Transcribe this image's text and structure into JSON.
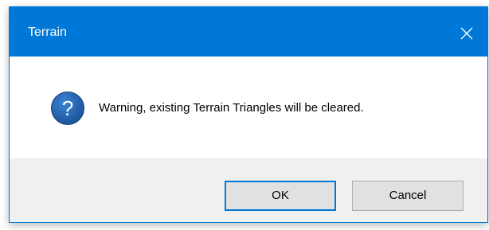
{
  "dialog": {
    "title": "Terrain",
    "close_icon": "close-icon",
    "message_icon": "question-icon",
    "message": "Warning, existing Terrain Triangles will be cleared.",
    "buttons": {
      "ok_label": "OK",
      "cancel_label": "Cancel"
    }
  },
  "colors": {
    "titlebar": "#0078d7",
    "footer": "#f0f0f0",
    "button": "#e1e1e1",
    "icon": "#1f5fa6"
  }
}
